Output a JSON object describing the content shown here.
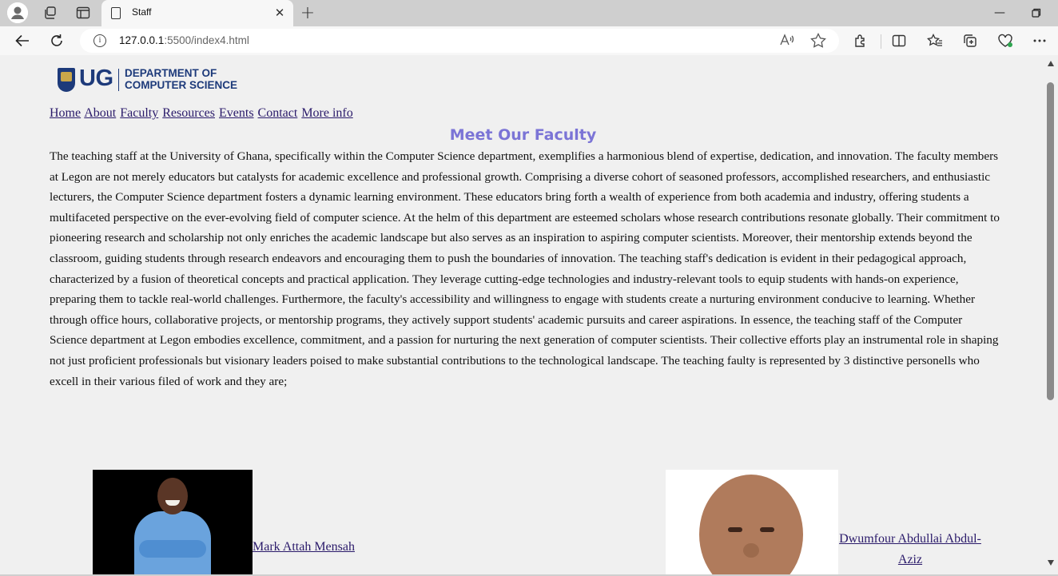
{
  "browser": {
    "tab_title": "Staff",
    "url_host": "127.0.0.1",
    "url_path": ":5500/index4.html"
  },
  "page": {
    "logo": {
      "ug": "UG",
      "dept_line1": "DEPARTMENT OF",
      "dept_line2": "COMPUTER SCIENCE"
    },
    "nav": [
      "Home",
      "About",
      "Faculty",
      "Resources",
      "Events",
      "Contact",
      "More info"
    ],
    "heading": "Meet Our Faculty",
    "intro": "The teaching staff at the University of Ghana, specifically within the Computer Science department, exemplifies a harmonious blend of expertise, dedication, and innovation. The faculty members at Legon are not merely educators but catalysts for academic excellence and professional growth. Comprising a diverse cohort of seasoned professors, accomplished researchers, and enthusiastic lecturers, the Computer Science department fosters a dynamic learning environment. These educators bring forth a wealth of experience from both academia and industry, offering students a multifaceted perspective on the ever-evolving field of computer science. At the helm of this department are esteemed scholars whose research contributions resonate globally. Their commitment to pioneering research and scholarship not only enriches the academic landscape but also serves as an inspiration to aspiring computer scientists. Moreover, their mentorship extends beyond the classroom, guiding students through research endeavors and encouraging them to push the boundaries of innovation. The teaching staff's dedication is evident in their pedagogical approach, characterized by a fusion of theoretical concepts and practical application. They leverage cutting-edge technologies and industry-relevant tools to equip students with hands-on experience, preparing them to tackle real-world challenges. Furthermore, the faculty's accessibility and willingness to engage with students create a nurturing environment conducive to learning. Whether through office hours, collaborative projects, or mentorship programs, they actively support students' academic pursuits and career aspirations. In essence, the teaching staff of the Computer Science department at Legon embodies excellence, commitment, and a passion for nurturing the next generation of computer scientists. Their collective efforts play an instrumental role in shaping not just proficient professionals but visionary leaders poised to make substantial contributions to the technological landscape. The teaching faulty is represented by 3 distinctive personells who excell in their various filed of work and they are;",
    "faculty": [
      {
        "name": "Mark Attah Mensah"
      },
      {
        "name": "Dwumfour Abdullai Abdul-Aziz"
      }
    ]
  },
  "colors": {
    "heading": "#7b74d6",
    "link": "#2a1a6a",
    "ug_blue": "#1d3a7a"
  }
}
